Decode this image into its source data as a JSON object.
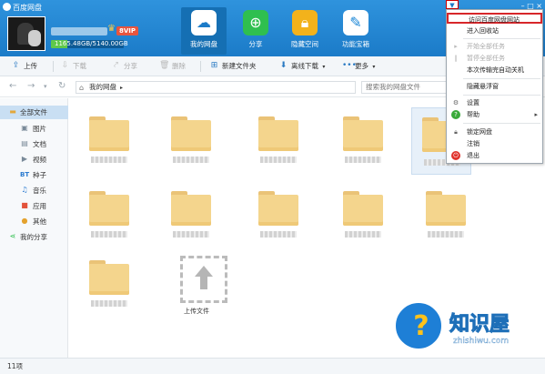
{
  "header": {
    "app_title": "百度网盘",
    "vip_label": "8VIP",
    "quota_text": "1165.48GB/5140.00GB",
    "quota_fraction": 0.227,
    "nav_tabs": [
      {
        "label": "我的网盘",
        "icon": "cloud-icon",
        "active": true
      },
      {
        "label": "分享",
        "icon": "share-icon",
        "active": false
      },
      {
        "label": "隐藏空间",
        "icon": "lock-icon",
        "active": false
      },
      {
        "label": "功能宝箱",
        "icon": "tools-icon",
        "active": false
      }
    ],
    "tab_colors": [
      "#ffffff",
      "#2fbf4f",
      "#f3b21b",
      "#1a86d6"
    ]
  },
  "toolbar": {
    "upload": "上传",
    "download": "下载",
    "share": "分享",
    "delete": "删除",
    "new_folder": "新建文件夹",
    "offline_download": "离线下载",
    "more": "更多"
  },
  "addressbar": {
    "breadcrumb": "我的网盘",
    "search_placeholder": "搜索我的网盘文件"
  },
  "sidebar": {
    "items": [
      {
        "label": "全部文件",
        "icon": "folder-icon",
        "selected": true
      },
      {
        "label": "图片",
        "icon": "image-icon"
      },
      {
        "label": "文档",
        "icon": "document-icon"
      },
      {
        "label": "视频",
        "icon": "video-icon"
      },
      {
        "label": "种子",
        "icon": "bt-icon",
        "icon_text": "BT"
      },
      {
        "label": "音乐",
        "icon": "music-icon"
      },
      {
        "label": "应用",
        "icon": "app-icon"
      },
      {
        "label": "其他",
        "icon": "other-icon"
      },
      {
        "label": "我的分享",
        "icon": "share-icon"
      }
    ]
  },
  "files": {
    "upload_label": "上传文件"
  },
  "status": {
    "item_count": "11项"
  },
  "menu": {
    "items": [
      {
        "label": "访问百度网盘网站",
        "highlight": true
      },
      {
        "label": "进入回收站"
      },
      {
        "label": "开始全部任务",
        "disabled": true
      },
      {
        "label": "暂停全部任务",
        "disabled": true
      },
      {
        "label": "本次传输完自动关机"
      },
      {
        "label": "隐藏悬浮窗"
      },
      {
        "label": "设置",
        "icon": "settings-icon"
      },
      {
        "label": "帮助",
        "icon": "help-icon",
        "submenu": true
      },
      {
        "label": "锁定网盘",
        "icon": "lock-icon"
      },
      {
        "label": "注销"
      },
      {
        "label": "退出",
        "icon": "exit-icon"
      }
    ]
  },
  "watermark": {
    "title": "知识屋",
    "url": "zhishiwu.com"
  }
}
